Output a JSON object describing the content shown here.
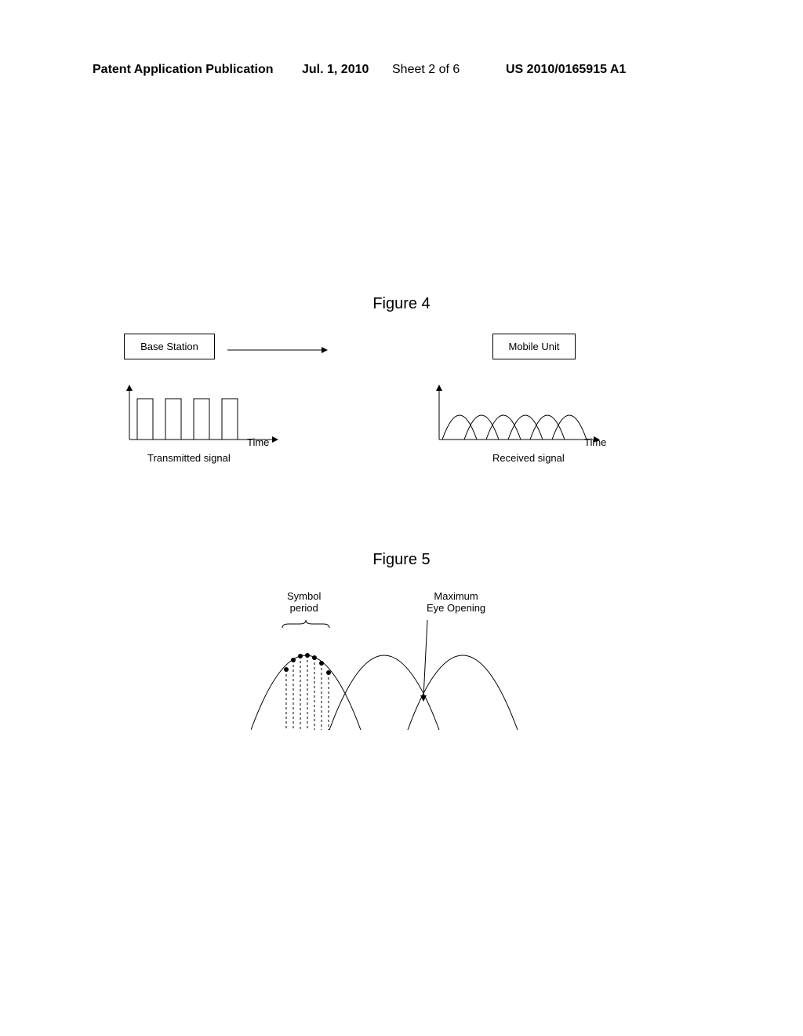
{
  "header": {
    "publication": "Patent Application Publication",
    "date": "Jul. 1, 2010",
    "sheet": "Sheet 2 of 6",
    "pubno": "US 2010/0165915 A1"
  },
  "figure4": {
    "title": "Figure 4",
    "base_station": "Base Station",
    "mobile_unit": "Mobile Unit",
    "time_label1": "Time",
    "time_label2": "Time",
    "transmitted": "Transmitted signal",
    "received": "Received signal"
  },
  "figure5": {
    "title": "Figure 5",
    "symbol_period": "Symbol\nperiod",
    "max_eye": "Maximum\nEye Opening"
  }
}
